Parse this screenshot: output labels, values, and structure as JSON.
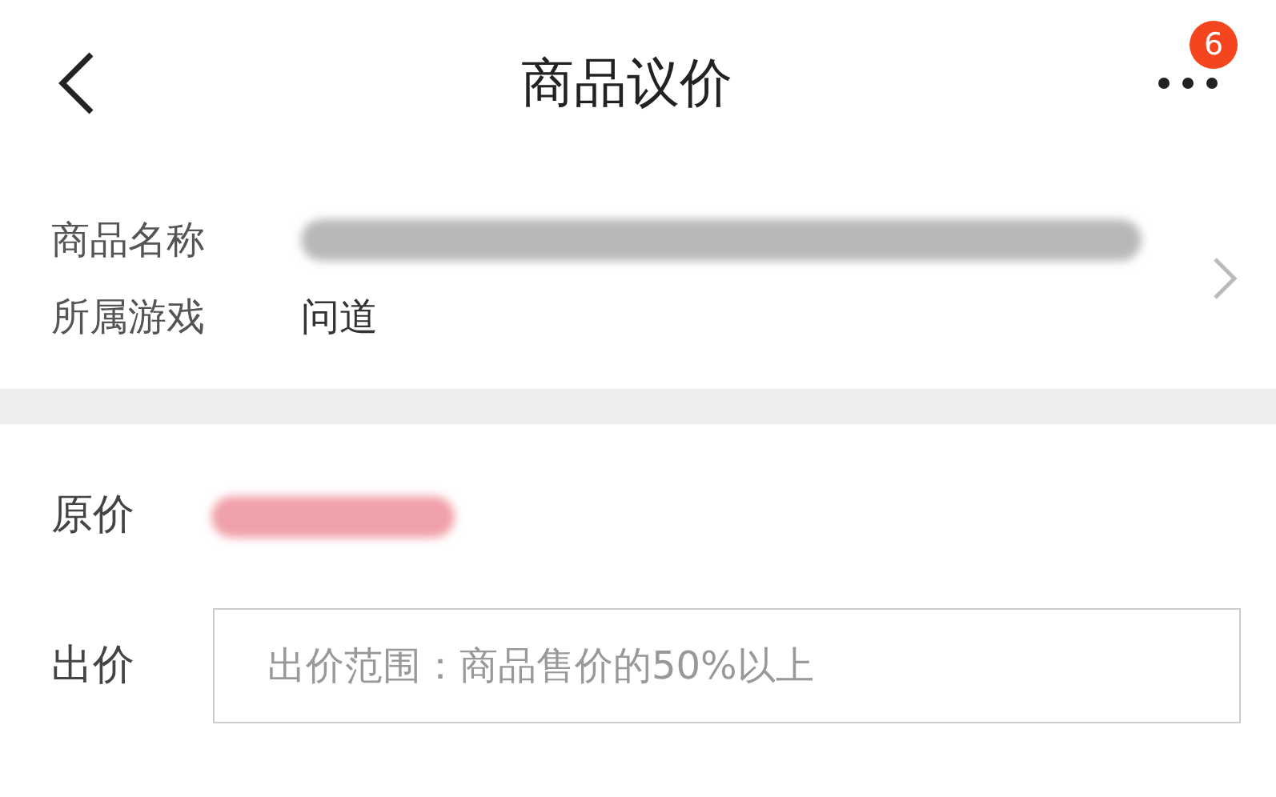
{
  "header": {
    "title": "商品议价",
    "badge": "6"
  },
  "info": [
    {
      "label": "商品名称",
      "redacted": true
    },
    {
      "label": "所属游戏",
      "value": "问道",
      "redacted": false
    }
  ],
  "price": {
    "label": "原价",
    "redacted": true
  },
  "offer": {
    "label": "出价",
    "placeholder": "出价范围：商品售价的50%以上"
  }
}
